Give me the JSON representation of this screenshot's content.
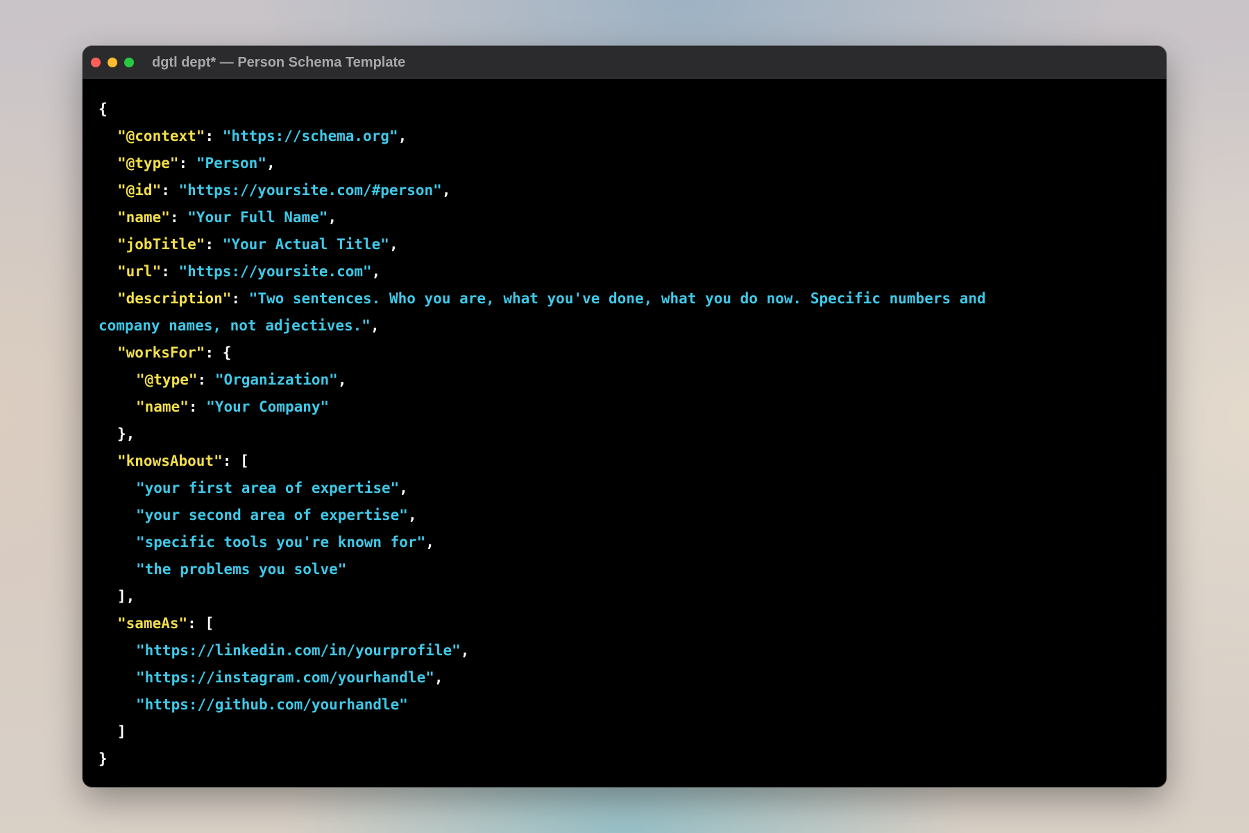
{
  "window": {
    "title": "dgtl dept* — Person Schema Template",
    "controls": {
      "close": "close-icon",
      "minimize": "minimize-icon",
      "zoom": "zoom-icon"
    },
    "colors": {
      "close": "#fe5f57",
      "minimize": "#febc2e",
      "zoom": "#28c840"
    }
  },
  "code": {
    "colors": {
      "key": "#f3df4b",
      "string": "#3fc9e8",
      "punctuation": "#ffffff",
      "background": "#000000"
    },
    "open_brace": "{",
    "close_brace": "}",
    "context": {
      "key": "\"@context\"",
      "value": "\"https://schema.org\""
    },
    "type": {
      "key": "\"@type\"",
      "value": "\"Person\""
    },
    "id": {
      "key": "\"@id\"",
      "value": "\"https://yoursite.com/#person\""
    },
    "name": {
      "key": "\"name\"",
      "value": "\"Your Full Name\""
    },
    "jobTitle": {
      "key": "\"jobTitle\"",
      "value": "\"Your Actual Title\""
    },
    "url": {
      "key": "\"url\"",
      "value": "\"https://yoursite.com\""
    },
    "description": {
      "key": "\"description\"",
      "value_line1": "\"Two sentences. Who you are, what you've done, what you do now. Specific numbers and",
      "value_line2": "company names, not adjectives.\""
    },
    "worksFor": {
      "key": "\"worksFor\"",
      "type_key": "\"@type\"",
      "type_value": "\"Organization\"",
      "name_key": "\"name\"",
      "name_value": "\"Your Company\""
    },
    "knowsAbout": {
      "key": "\"knowsAbout\"",
      "items": [
        "\"your first area of expertise\"",
        "\"your second area of expertise\"",
        "\"specific tools you're known for\"",
        "\"the problems you solve\""
      ]
    },
    "sameAs": {
      "key": "\"sameAs\"",
      "items": [
        "\"https://linkedin.com/in/yourprofile\"",
        "\"https://instagram.com/yourhandle\"",
        "\"https://github.com/yourhandle\""
      ]
    }
  }
}
